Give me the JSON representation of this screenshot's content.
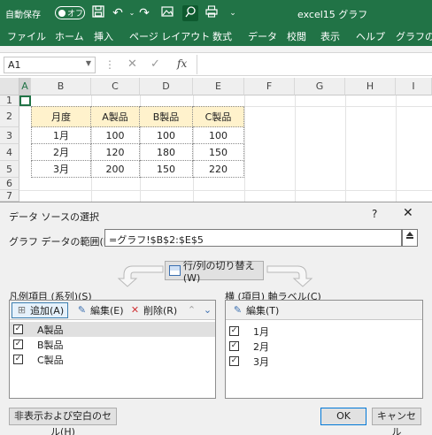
{
  "titlebar": {
    "autosave_label": "自動保存",
    "autosave_state": "オフ",
    "doc_title": "excel15 グラフ",
    "more": "⌄"
  },
  "ribbon": {
    "tabs": [
      "ファイル",
      "ホーム",
      "挿入",
      "ページ レイアウト",
      "数式",
      "データ",
      "校閲",
      "表示",
      "ヘルプ",
      "グラフのデ"
    ]
  },
  "formula_bar": {
    "name_box": "A1",
    "fx": "fx",
    "formula": ""
  },
  "sheet": {
    "columns": [
      "A",
      "B",
      "C",
      "D",
      "E",
      "F",
      "G",
      "H",
      "I"
    ],
    "rows": [
      "1",
      "2",
      "3",
      "4",
      "5",
      "6",
      "7"
    ],
    "table_header": [
      "月度",
      "A製品",
      "B製品",
      "C製品"
    ],
    "table_rows": [
      [
        "1月",
        "100",
        "100",
        "100"
      ],
      [
        "2月",
        "120",
        "180",
        "150"
      ],
      [
        "3月",
        "200",
        "150",
        "220"
      ]
    ]
  },
  "dialog": {
    "title": "データ ソースの選択",
    "help": "?",
    "close": "✕",
    "range_label": "グラフ データの範囲(D):",
    "range_value": "=グラフ!$B$2:$E$5",
    "swap_label": "行/列の切り替え(W)",
    "legend_label": "凡例項目 (系列)(S)",
    "add_label": "追加(A)",
    "edit_label": "編集(E)",
    "delete_label": "削除(R)",
    "series": [
      "A製品",
      "B製品",
      "C製品"
    ],
    "axis_label": "横 (項目) 軸ラベル(C)",
    "axis_edit_label": "編集(T)",
    "categories": [
      "1月",
      "2月",
      "3月"
    ],
    "hidden_cells_label": "非表示および空白のセル(H)",
    "ok_label": "OK",
    "cancel_label": "キャンセル"
  }
}
